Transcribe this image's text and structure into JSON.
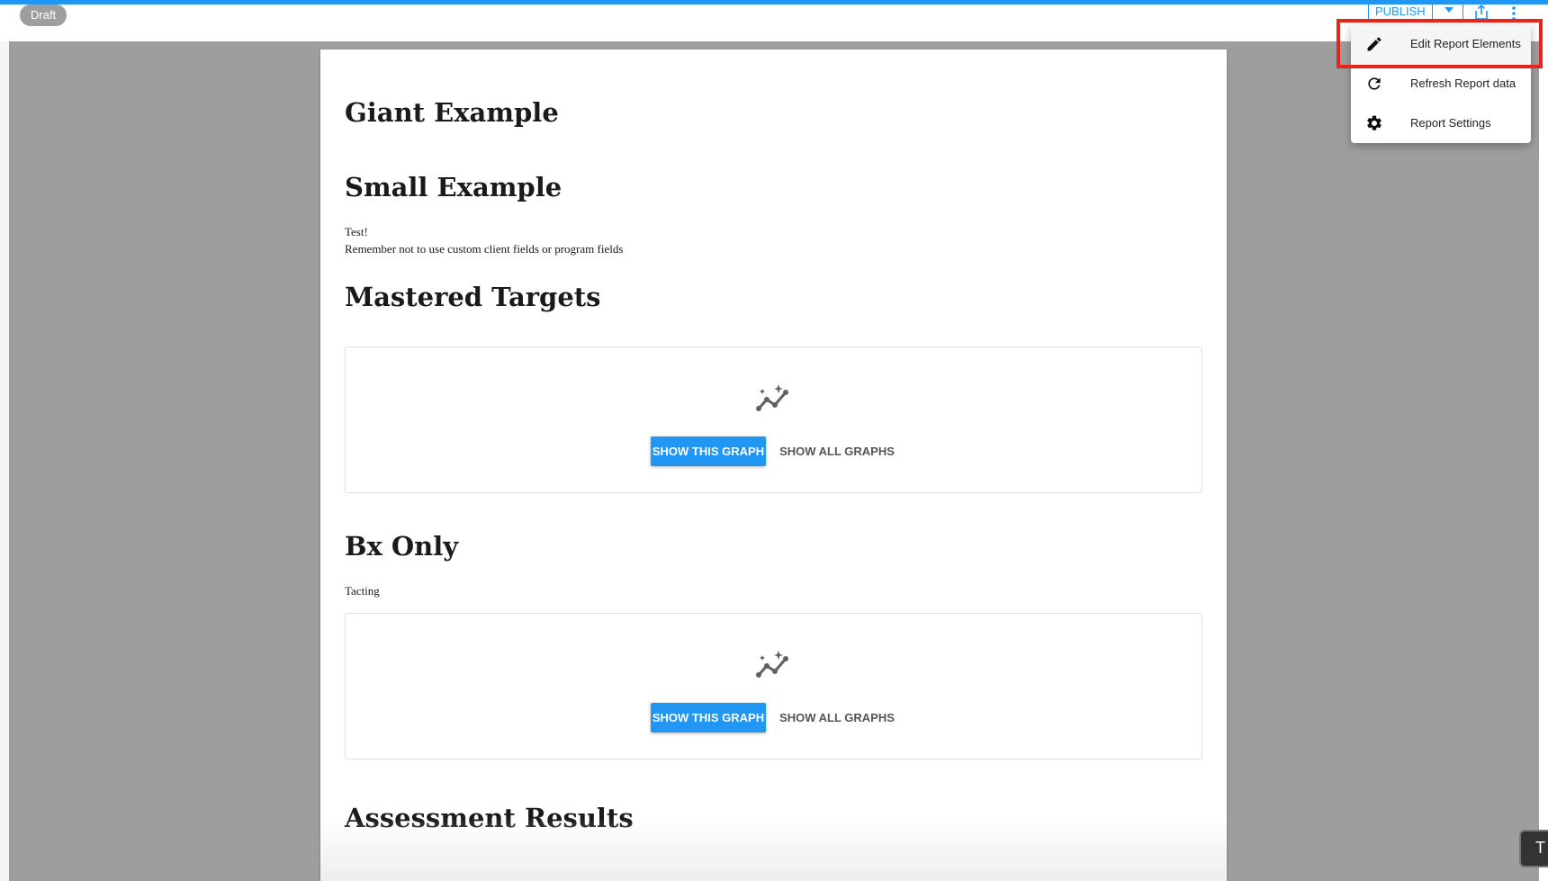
{
  "topbar": {
    "status_chip": "Draft",
    "publish_label": "PUBLISH"
  },
  "menu": {
    "items": [
      {
        "label": "Edit Report Elements",
        "icon": "pencil-icon",
        "highlighted": true
      },
      {
        "label": "Refresh Report data",
        "icon": "refresh-icon"
      },
      {
        "label": "Report Settings",
        "icon": "gear-icon"
      }
    ]
  },
  "report": {
    "sections": [
      {
        "title": "Giant Example"
      },
      {
        "title": "Small Example",
        "lines": [
          "Test!",
          "Remember not to use custom client fields or program fields"
        ]
      },
      {
        "title": "Mastered Targets"
      },
      {
        "title": "Bx Only",
        "lines": [
          "Tacting"
        ]
      },
      {
        "title": "Assessment Results"
      }
    ],
    "graph_cards": [
      {
        "primary_label": "SHOW THIS GRAPH",
        "secondary_label": "SHOW ALL GRAPHS",
        "icon": "graph-sparkle-icon"
      },
      {
        "primary_label": "SHOW THIS GRAPH",
        "secondary_label": "SHOW ALL GRAPHS",
        "icon": "graph-sparkle-icon"
      }
    ]
  },
  "corner_tab": {
    "label": "T"
  },
  "colors": {
    "accent": "#2196f3",
    "highlight": "#e4261c",
    "canvas": "#9e9e9e"
  }
}
